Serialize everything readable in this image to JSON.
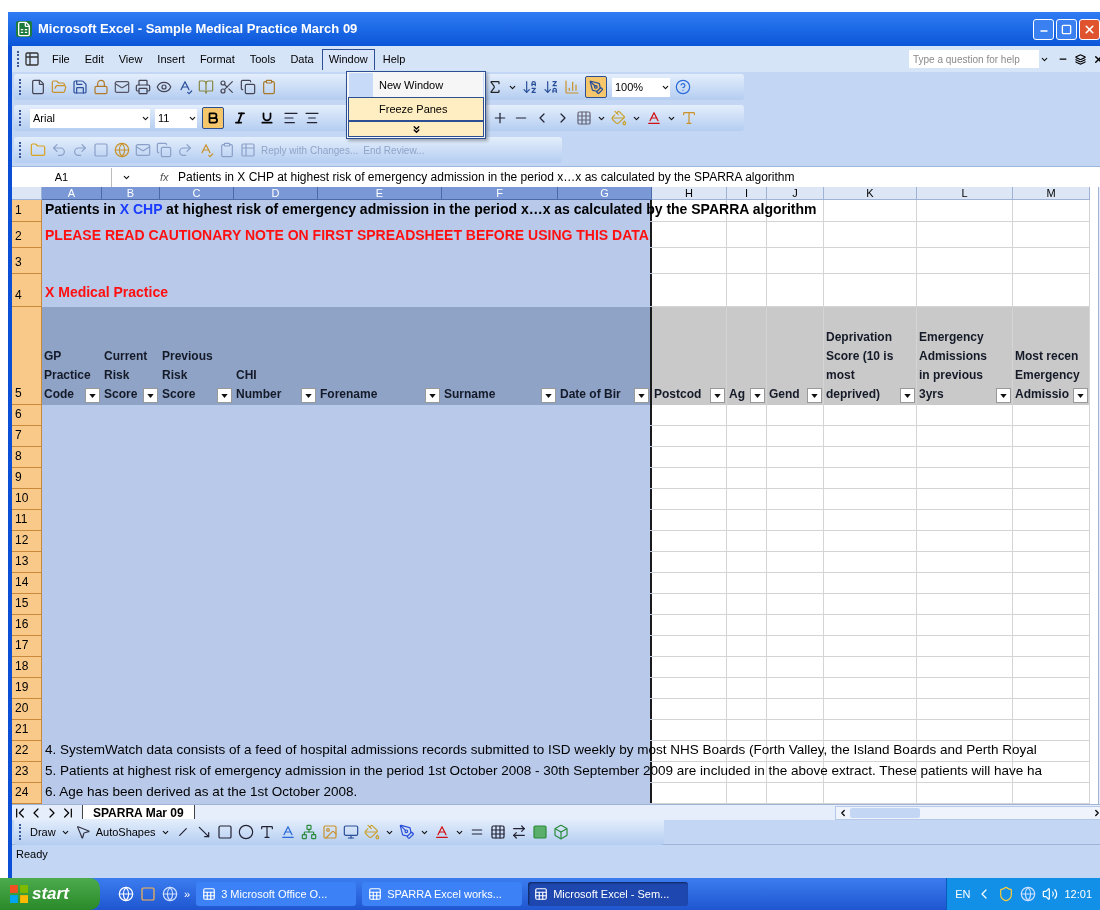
{
  "window": {
    "title": "Microsoft Excel - Sample Medical Practice March 09"
  },
  "menu_bar": [
    {
      "label": "File",
      "selected": false
    },
    {
      "label": "Edit",
      "selected": false
    },
    {
      "label": "View",
      "selected": false
    },
    {
      "label": "Insert",
      "selected": false
    },
    {
      "label": "Format",
      "selected": false
    },
    {
      "label": "Tools",
      "selected": false
    },
    {
      "label": "Data",
      "selected": false
    },
    {
      "label": "Window",
      "selected": true
    },
    {
      "label": "Help",
      "selected": false
    }
  ],
  "open_menu": {
    "items": [
      {
        "label": "New Window",
        "selected": false
      },
      {
        "label": "Freeze Panes",
        "selected": true
      }
    ]
  },
  "help_box": {
    "placeholder": "Type a question for help"
  },
  "standard_toolbar": {
    "zoom": "100%",
    "drawing_on": true
  },
  "formatting_toolbar": {
    "font": "Arial",
    "size": "11",
    "bold": true,
    "italic": false,
    "underline": false
  },
  "review_toolbar": {
    "disabled": true,
    "buttons": [
      "Reply with Changes...",
      "End Review..."
    ]
  },
  "formula_bar": {
    "name_box": "A1",
    "fx": "fx",
    "formula": "Patients in X CHP at highest risk of emergency admission in the period x…x as calculated by the SPARRA algorithm"
  },
  "columns": [
    {
      "letter": "A",
      "selected": true
    },
    {
      "letter": "B",
      "selected": true
    },
    {
      "letter": "C",
      "selected": true
    },
    {
      "letter": "D",
      "selected": true
    },
    {
      "letter": "E",
      "selected": true
    },
    {
      "letter": "F",
      "selected": true
    },
    {
      "letter": "G",
      "selected": true
    },
    {
      "letter": "H",
      "selected": false
    },
    {
      "letter": "I",
      "selected": false
    },
    {
      "letter": "J",
      "selected": false
    },
    {
      "letter": "K",
      "selected": false
    },
    {
      "letter": "L",
      "selected": false
    },
    {
      "letter": "M",
      "selected": false
    }
  ],
  "rows": [
    {
      "number": "1",
      "selected": true,
      "kind": "title",
      "segments": [
        {
          "text": "Patients in ",
          "color": "#000000"
        },
        {
          "text": "X CHP",
          "color": "#1a3cff"
        },
        {
          "text": " at highest risk of emergency admission in the period x…x as calculated by the SPARRA algorithm",
          "color": "#000000"
        }
      ]
    },
    {
      "number": "2",
      "selected": true,
      "kind": "warning",
      "text": "PLEASE READ CAUTIONARY NOTE ON FIRST SPREADSHEET BEFORE USING THIS DATA"
    },
    {
      "number": "3",
      "selected": true,
      "kind": "blank"
    },
    {
      "number": "4",
      "selected": true,
      "kind": "section",
      "text": "X Medical Practice"
    },
    {
      "number": "5",
      "selected": true,
      "kind": "header",
      "cells": [
        "GP\nPractice\nCode",
        "Current\nRisk\nScore",
        "Previous\nRisk\nScore",
        "CHI\nNumber",
        "Forename",
        "Surname",
        "Date of Bir",
        "Postcod",
        "Ag",
        "Gend",
        "Deprivation\nScore (10 is\nmost\ndeprived)",
        "Emergency\nAdmissions\nin previous\n3yrs",
        "Most recen\nEmergency\nAdmissio"
      ]
    },
    {
      "number": "6",
      "selected": true,
      "kind": "blank"
    },
    {
      "number": "7",
      "selected": true,
      "kind": "blank"
    },
    {
      "number": "8",
      "selected": true,
      "kind": "blank"
    },
    {
      "number": "9",
      "selected": true,
      "kind": "blank"
    },
    {
      "number": "10",
      "selected": true,
      "kind": "blank"
    },
    {
      "number": "11",
      "selected": true,
      "kind": "blank"
    },
    {
      "number": "12",
      "selected": true,
      "kind": "blank"
    },
    {
      "number": "13",
      "selected": true,
      "kind": "blank"
    },
    {
      "number": "14",
      "selected": true,
      "kind": "blank"
    },
    {
      "number": "15",
      "selected": true,
      "kind": "blank"
    },
    {
      "number": "16",
      "selected": true,
      "kind": "blank"
    },
    {
      "number": "17",
      "selected": true,
      "kind": "blank"
    },
    {
      "number": "18",
      "selected": true,
      "kind": "blank"
    },
    {
      "number": "19",
      "selected": true,
      "kind": "blank"
    },
    {
      "number": "20",
      "selected": true,
      "kind": "blank"
    },
    {
      "number": "21",
      "selected": true,
      "kind": "blank"
    },
    {
      "number": "22",
      "selected": true,
      "kind": "note",
      "text": "4. SystemWatch data consists of a feed of hospital admissions records submitted to ISD weekly by most NHS Boards (Forth Valley, the Island Boards and Perth Royal"
    },
    {
      "number": "23",
      "selected": true,
      "kind": "note",
      "text": "5. Patients at highest risk of emergency admission in the period 1st October 2008 - 30th September 2009 are included in the above extract.  These patients will have ha"
    },
    {
      "number": "24",
      "selected": true,
      "kind": "note",
      "text": "6. Age has been derived as at the 1st October 2008."
    }
  ],
  "sheet_tabs": [
    {
      "label": "SPARRA Mar 09",
      "selected": true
    }
  ],
  "drawing_toolbar": {
    "draw": "Draw",
    "autoshapes": "AutoShapes"
  },
  "status_bar": {
    "text": "Ready"
  },
  "taskbar": {
    "start": "start",
    "overflow": "»",
    "tasks": [
      {
        "label": "3 Microsoft Office O...",
        "selected": false
      },
      {
        "label": "SPARRA Excel works...",
        "selected": false
      },
      {
        "label": "Microsoft Excel - Sem...",
        "selected": true
      }
    ],
    "language": "EN",
    "clock": "12:01"
  }
}
